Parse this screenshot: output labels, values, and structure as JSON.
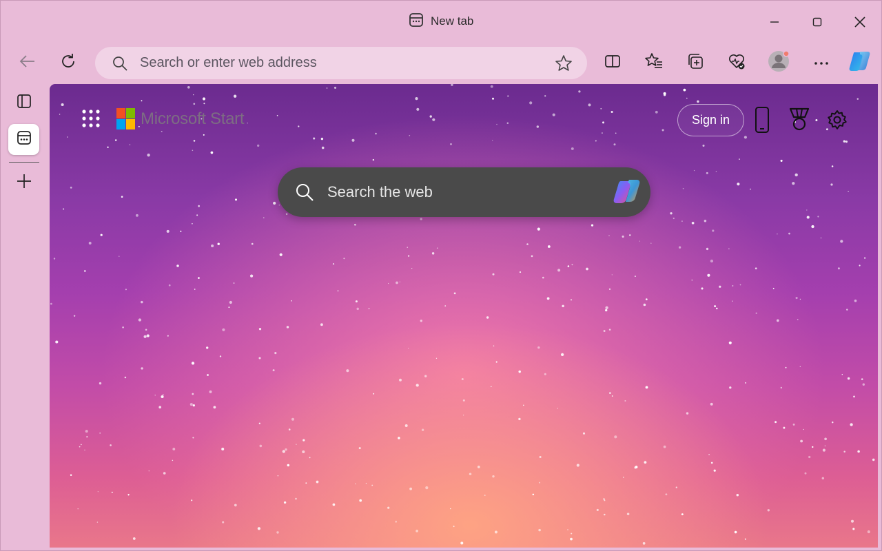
{
  "window": {
    "tab_title": "New tab",
    "controls": [
      "minimize-icon",
      "maximize-icon",
      "close-icon"
    ]
  },
  "toolbar": {
    "address_placeholder": "Search or enter web address",
    "address_value": "",
    "icons": [
      "back-arrow-icon",
      "refresh-icon",
      "search-icon",
      "favorite-star-icon",
      "split-screen-icon",
      "favorites-icon",
      "collections-icon",
      "browser-essentials-icon",
      "profile-avatar",
      "more-options-icon",
      "copilot-icon"
    ]
  },
  "sidebar": {
    "items": [
      "tab-actions-icon",
      "new-tab-page-icon",
      "new-tab-plus-icon"
    ]
  },
  "start_page": {
    "brand": "Microsoft Start",
    "sign_in_label": "Sign in",
    "search_placeholder": "Search the web",
    "search_value": "",
    "header_icons": [
      "apps-grid-icon",
      "phone-icon",
      "rewards-medal-icon",
      "settings-gear-icon"
    ],
    "colors": {
      "logo_red": "#f25022",
      "logo_green": "#7fba00",
      "logo_blue": "#00a4ef",
      "logo_yellow": "#ffb900",
      "search_box_bg": "#4a4a4a",
      "chrome_bg": "#e9bbd8"
    }
  }
}
